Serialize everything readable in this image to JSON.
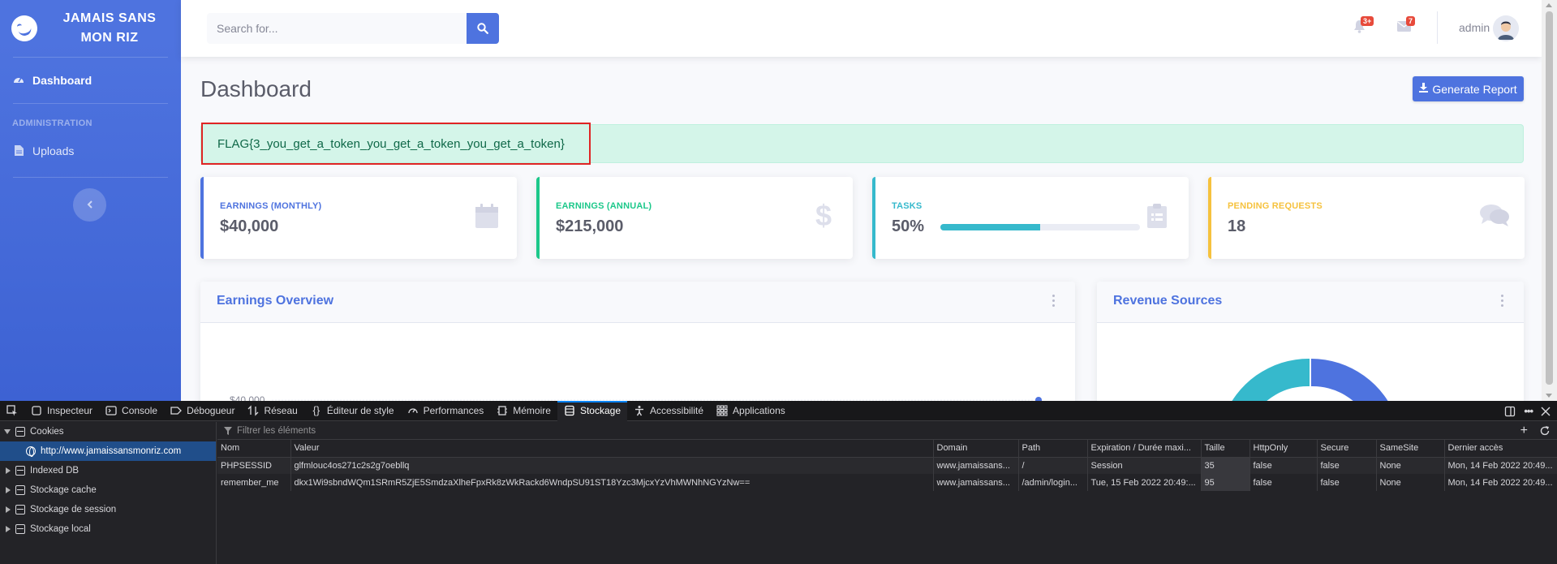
{
  "brand": {
    "line1": "JAMAIS SANS",
    "line2": "MON RIZ"
  },
  "sidebar": {
    "dashboard": "Dashboard",
    "heading": "ADMINISTRATION",
    "uploads": "Uploads"
  },
  "topbar": {
    "search_placeholder": "Search for...",
    "alerts_badge": "3+",
    "messages_badge": "7",
    "user": "admin"
  },
  "page": {
    "title": "Dashboard",
    "report_button": "Generate Report",
    "flag": "FLAG{3_you_get_a_token_you_get_a_token_you_get_a_token}"
  },
  "stats": [
    {
      "label": "EARNINGS (MONTHLY)",
      "value": "$40,000",
      "color": "#4e73df",
      "icon": "calendar-icon"
    },
    {
      "label": "EARNINGS (ANNUAL)",
      "value": "$215,000",
      "color": "#1cc88a",
      "icon": "dollar-icon"
    },
    {
      "label": "TASKS",
      "value": "50%",
      "color": "#36b9cc",
      "icon": "clipboard-icon",
      "progress": 0.5
    },
    {
      "label": "PENDING REQUESTS",
      "value": "18",
      "color": "#f6c23e",
      "icon": "comments-icon"
    }
  ],
  "earnings": {
    "title": "Earnings Overview",
    "tick_label": "$40,000"
  },
  "revenue": {
    "title": "Revenue Sources"
  },
  "devtools": {
    "tabs": [
      "Inspecteur",
      "Console",
      "Débogueur",
      "Réseau",
      "Éditeur de style",
      "Performances",
      "Mémoire",
      "Stockage",
      "Accessibilité",
      "Applications"
    ],
    "active_tab": "Stockage",
    "tree": {
      "cookies": "Cookies",
      "host": "http://www.jamaissansmonriz.com",
      "indexed_db": "Indexed DB",
      "cache": "Stockage cache",
      "session": "Stockage de session",
      "local": "Stockage local"
    },
    "filter_placeholder": "Filtrer les éléments",
    "columns": [
      "Nom",
      "Valeur",
      "Domain",
      "Path",
      "Expiration / Durée maxi...",
      "Taille",
      "HttpOnly",
      "Secure",
      "SameSite",
      "Dernier accès"
    ],
    "rows": [
      [
        "PHPSESSID",
        "glfmlouc4os271c2s2g7oebllq",
        "www.jamaissans...",
        "/",
        "Session",
        "35",
        "false",
        "false",
        "None",
        "Mon, 14 Feb 2022 20:49..."
      ],
      [
        "remember_me",
        "dkx1Wi9sbndWQm1SRmR5ZjE5SmdzaXlheFpxRk8zWkRackd6WndpSU91ST18Yzc3MjcxYzVhMWNhNGYzNw==",
        "www.jamaissans...",
        "/admin/login...",
        "Tue, 15 Feb 2022 20:49:...",
        "95",
        "false",
        "false",
        "None",
        "Mon, 14 Feb 2022 20:49..."
      ]
    ]
  },
  "colors": {
    "primary": "#4e73df",
    "success": "#1cc88a",
    "info": "#36b9cc",
    "warning": "#f6c23e",
    "danger": "#e74a3b"
  }
}
